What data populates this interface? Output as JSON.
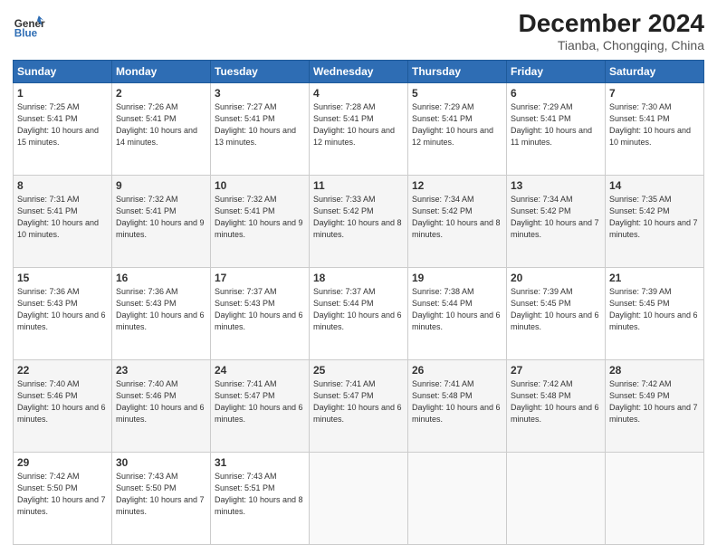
{
  "logo": {
    "general": "General",
    "blue": "Blue"
  },
  "header": {
    "title": "December 2024",
    "subtitle": "Tianba, Chongqing, China"
  },
  "weekdays": [
    "Sunday",
    "Monday",
    "Tuesday",
    "Wednesday",
    "Thursday",
    "Friday",
    "Saturday"
  ],
  "weeks": [
    [
      {
        "day": 1,
        "sunrise": "7:25 AM",
        "sunset": "5:41 PM",
        "daylight": "10 hours and 15 minutes."
      },
      {
        "day": 2,
        "sunrise": "7:26 AM",
        "sunset": "5:41 PM",
        "daylight": "10 hours and 14 minutes."
      },
      {
        "day": 3,
        "sunrise": "7:27 AM",
        "sunset": "5:41 PM",
        "daylight": "10 hours and 13 minutes."
      },
      {
        "day": 4,
        "sunrise": "7:28 AM",
        "sunset": "5:41 PM",
        "daylight": "10 hours and 12 minutes."
      },
      {
        "day": 5,
        "sunrise": "7:29 AM",
        "sunset": "5:41 PM",
        "daylight": "10 hours and 12 minutes."
      },
      {
        "day": 6,
        "sunrise": "7:29 AM",
        "sunset": "5:41 PM",
        "daylight": "10 hours and 11 minutes."
      },
      {
        "day": 7,
        "sunrise": "7:30 AM",
        "sunset": "5:41 PM",
        "daylight": "10 hours and 10 minutes."
      }
    ],
    [
      {
        "day": 8,
        "sunrise": "7:31 AM",
        "sunset": "5:41 PM",
        "daylight": "10 hours and 10 minutes."
      },
      {
        "day": 9,
        "sunrise": "7:32 AM",
        "sunset": "5:41 PM",
        "daylight": "10 hours and 9 minutes."
      },
      {
        "day": 10,
        "sunrise": "7:32 AM",
        "sunset": "5:41 PM",
        "daylight": "10 hours and 9 minutes."
      },
      {
        "day": 11,
        "sunrise": "7:33 AM",
        "sunset": "5:42 PM",
        "daylight": "10 hours and 8 minutes."
      },
      {
        "day": 12,
        "sunrise": "7:34 AM",
        "sunset": "5:42 PM",
        "daylight": "10 hours and 8 minutes."
      },
      {
        "day": 13,
        "sunrise": "7:34 AM",
        "sunset": "5:42 PM",
        "daylight": "10 hours and 7 minutes."
      },
      {
        "day": 14,
        "sunrise": "7:35 AM",
        "sunset": "5:42 PM",
        "daylight": "10 hours and 7 minutes."
      }
    ],
    [
      {
        "day": 15,
        "sunrise": "7:36 AM",
        "sunset": "5:43 PM",
        "daylight": "10 hours and 6 minutes."
      },
      {
        "day": 16,
        "sunrise": "7:36 AM",
        "sunset": "5:43 PM",
        "daylight": "10 hours and 6 minutes."
      },
      {
        "day": 17,
        "sunrise": "7:37 AM",
        "sunset": "5:43 PM",
        "daylight": "10 hours and 6 minutes."
      },
      {
        "day": 18,
        "sunrise": "7:37 AM",
        "sunset": "5:44 PM",
        "daylight": "10 hours and 6 minutes."
      },
      {
        "day": 19,
        "sunrise": "7:38 AM",
        "sunset": "5:44 PM",
        "daylight": "10 hours and 6 minutes."
      },
      {
        "day": 20,
        "sunrise": "7:39 AM",
        "sunset": "5:45 PM",
        "daylight": "10 hours and 6 minutes."
      },
      {
        "day": 21,
        "sunrise": "7:39 AM",
        "sunset": "5:45 PM",
        "daylight": "10 hours and 6 minutes."
      }
    ],
    [
      {
        "day": 22,
        "sunrise": "7:40 AM",
        "sunset": "5:46 PM",
        "daylight": "10 hours and 6 minutes."
      },
      {
        "day": 23,
        "sunrise": "7:40 AM",
        "sunset": "5:46 PM",
        "daylight": "10 hours and 6 minutes."
      },
      {
        "day": 24,
        "sunrise": "7:41 AM",
        "sunset": "5:47 PM",
        "daylight": "10 hours and 6 minutes."
      },
      {
        "day": 25,
        "sunrise": "7:41 AM",
        "sunset": "5:47 PM",
        "daylight": "10 hours and 6 minutes."
      },
      {
        "day": 26,
        "sunrise": "7:41 AM",
        "sunset": "5:48 PM",
        "daylight": "10 hours and 6 minutes."
      },
      {
        "day": 27,
        "sunrise": "7:42 AM",
        "sunset": "5:48 PM",
        "daylight": "10 hours and 6 minutes."
      },
      {
        "day": 28,
        "sunrise": "7:42 AM",
        "sunset": "5:49 PM",
        "daylight": "10 hours and 7 minutes."
      }
    ],
    [
      {
        "day": 29,
        "sunrise": "7:42 AM",
        "sunset": "5:50 PM",
        "daylight": "10 hours and 7 minutes."
      },
      {
        "day": 30,
        "sunrise": "7:43 AM",
        "sunset": "5:50 PM",
        "daylight": "10 hours and 7 minutes."
      },
      {
        "day": 31,
        "sunrise": "7:43 AM",
        "sunset": "5:51 PM",
        "daylight": "10 hours and 8 minutes."
      },
      null,
      null,
      null,
      null
    ]
  ]
}
